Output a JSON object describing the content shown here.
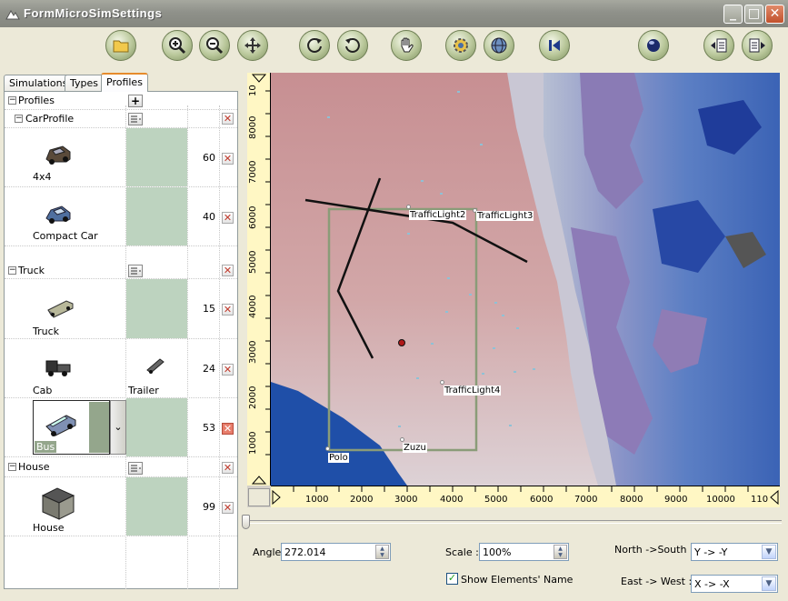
{
  "window": {
    "title": "FormMicroSimSettings",
    "minimize": "_",
    "maximize": "□",
    "close": "✕"
  },
  "toolbar": {
    "buttons": [
      {
        "name": "open-folder",
        "icon": "folder-icon"
      },
      {
        "name": "zoom-in",
        "icon": "zoom-in-icon"
      },
      {
        "name": "zoom-out",
        "icon": "zoom-out-icon"
      },
      {
        "name": "pan",
        "icon": "move-icon"
      },
      {
        "name": "rotate-left",
        "icon": "rotate-left-icon"
      },
      {
        "name": "rotate-right",
        "icon": "rotate-right-icon"
      },
      {
        "name": "hand",
        "icon": "hand-icon"
      },
      {
        "name": "settings",
        "icon": "gear-icon"
      },
      {
        "name": "world",
        "icon": "globe-icon"
      },
      {
        "name": "first",
        "icon": "skip-back-icon"
      },
      {
        "name": "sphere",
        "icon": "sphere-icon"
      },
      {
        "name": "add-list",
        "icon": "add-list-icon"
      },
      {
        "name": "remove-list",
        "icon": "remove-list-icon"
      }
    ]
  },
  "tabs": [
    {
      "label": "Simulations"
    },
    {
      "label": "Types"
    },
    {
      "label": "Profiles",
      "active": true
    }
  ],
  "tree": {
    "root_label": "Profiles",
    "groups": [
      {
        "label": "CarProfile",
        "items": [
          {
            "label": "4x4",
            "value": "60"
          },
          {
            "label": "Compact Car",
            "value": "40"
          }
        ]
      },
      {
        "label": "Truck",
        "items": [
          {
            "label": "Truck",
            "value": "15"
          },
          {
            "label": "Cab",
            "label2": "Trailer",
            "value": "24"
          },
          {
            "label": "Bus",
            "value": "53",
            "selected": true
          }
        ]
      },
      {
        "label": "House",
        "items": [
          {
            "label": "House",
            "value": "99"
          }
        ]
      }
    ]
  },
  "map": {
    "y_ticks": [
      "1000",
      "2000",
      "3000",
      "4000",
      "5000",
      "6000",
      "7000",
      "8000",
      "10"
    ],
    "x_ticks": [
      "1000",
      "2000",
      "3000",
      "4000",
      "5000",
      "6000",
      "7000",
      "8000",
      "9000",
      "10000",
      "110"
    ],
    "labels": {
      "tl2": "TrafficLight2",
      "tl3": "TrafficLight3",
      "tl4": "TrafficLight4",
      "zuzu": "Zuzu",
      "polo": "Polo"
    }
  },
  "controls": {
    "angle_label": "Angle",
    "angle_value": "272.014",
    "scale_label": "Scale :",
    "scale_value": "100%",
    "ns_label": "North ->South :",
    "ns_value": "Y -> -Y",
    "ew_label": "East -> West :",
    "ew_value": "X -> -X",
    "show_names_label": "Show Elements' Name",
    "show_names_checked": true
  },
  "colors": {
    "title_bar": "#8f918a",
    "tab_accent": "#e68b2c",
    "green_cell": "#bdd3bf",
    "ruler": "#fff7c4"
  }
}
